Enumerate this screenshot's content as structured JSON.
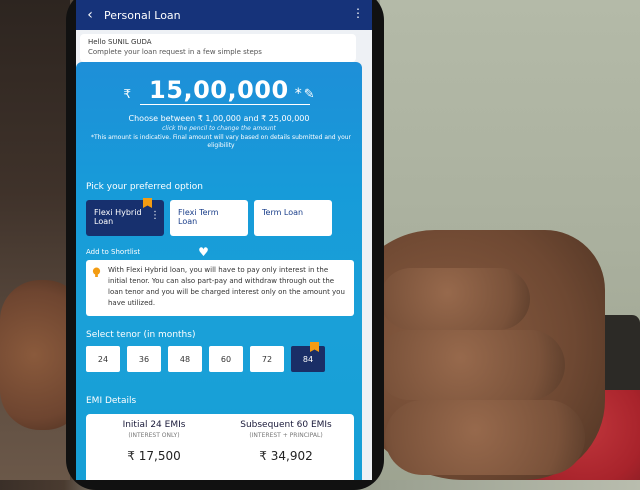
{
  "app": {
    "title": "Personal Loan"
  },
  "greeting": {
    "hello": "Hello SUNIL GUDA",
    "subtitle": "Complete your loan request in a few simple steps"
  },
  "loan": {
    "currency_symbol": "₹",
    "amount": "15,00,000",
    "asterisk": "*",
    "range_text": "Choose between ₹ 1,00,000 and ₹ 25,00,000",
    "pencil_hint": "click the pencil to change the amount",
    "disclaimer": "*This amount is indicative. Final amount will vary based on details submitted and your eligibility"
  },
  "options": {
    "heading": "Pick your preferred option",
    "items": [
      {
        "label": "Flexi Hybrid Loan",
        "selected": true
      },
      {
        "label": "Flexi Term Loan",
        "selected": false
      },
      {
        "label": "Term Loan",
        "selected": false
      }
    ],
    "shortlist_label": "Add to Shortlist",
    "info_text": "With Flexi Hybrid loan, you will have to pay only interest in the initial tenor. You can also part-pay and withdraw through out the loan tenor and you will be charged interest only on the amount you have utilized."
  },
  "tenor": {
    "heading": "Select tenor (in months)",
    "values": [
      "24",
      "36",
      "48",
      "60",
      "72",
      "84"
    ],
    "selected": "84"
  },
  "emi": {
    "heading": "EMI Details",
    "initial": {
      "title": "Initial 24 EMIs",
      "sub": "(INTEREST ONLY)",
      "value": "₹ 17,500"
    },
    "subsequent": {
      "title": "Subsequent 60 EMIs",
      "sub": "(INTEREST + PRINCIPAL)",
      "value": "₹ 34,902"
    }
  },
  "colors": {
    "brand_dark": "#16337a",
    "card_blue": "#1a9bd9",
    "flag_orange": "#f39c12"
  }
}
